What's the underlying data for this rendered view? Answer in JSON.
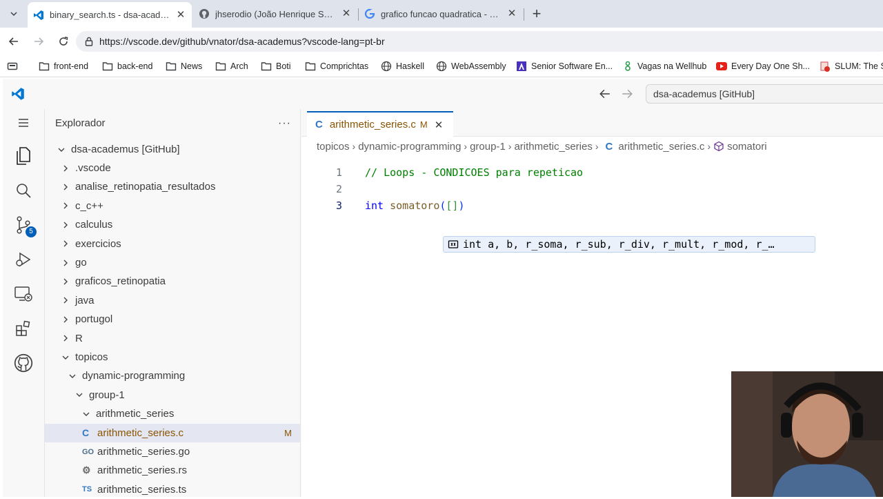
{
  "browser": {
    "tabs": [
      {
        "title": "binary_search.ts - dsa-academus [Gi",
        "icon": "vscode-icon",
        "active": true
      },
      {
        "title": "jhserodio (João Henrique Serodio)",
        "icon": "github-icon",
        "active": false
      },
      {
        "title": "grafico funcao quadratica - Pesqu",
        "icon": "google-icon",
        "active": false
      }
    ],
    "tab_close": "✕",
    "new_tab": "+",
    "url": "https://vscode.dev/github/vnator/dsa-academus?vscode-lang=pt-br",
    "bookmarks": [
      {
        "label": "front-end",
        "icon": "folder-icon"
      },
      {
        "label": "back-end",
        "icon": "folder-icon"
      },
      {
        "label": "News",
        "icon": "folder-icon"
      },
      {
        "label": "Arch",
        "icon": "folder-icon"
      },
      {
        "label": "Boti",
        "icon": "folder-icon"
      },
      {
        "label": "Comprichtas",
        "icon": "folder-icon"
      },
      {
        "label": "Haskell",
        "icon": "globe-icon"
      },
      {
        "label": "WebAssembly",
        "icon": "globe-icon"
      },
      {
        "label": "Senior Software En...",
        "icon": "bookmark-icon"
      },
      {
        "label": "Vagas na Wellhub",
        "icon": "wellhub-icon"
      },
      {
        "label": "Every Day One Sh...",
        "icon": "youtube-icon"
      },
      {
        "label": "SLUM: The Sh",
        "icon": "bookmark-icon"
      }
    ]
  },
  "vscode": {
    "command_center": "dsa-academus [GitHub]",
    "scm_badge": "5",
    "explorer": {
      "title": "Explorador",
      "root": "dsa-academus [GitHub]",
      "items": [
        {
          "label": ".vscode",
          "type": "folder",
          "expanded": false,
          "depth": 1
        },
        {
          "label": "analise_retinopatia_resultados",
          "type": "folder",
          "expanded": false,
          "depth": 1
        },
        {
          "label": "c_c++",
          "type": "folder",
          "expanded": false,
          "depth": 1
        },
        {
          "label": "calculus",
          "type": "folder",
          "expanded": false,
          "depth": 1
        },
        {
          "label": "exercicios",
          "type": "folder",
          "expanded": false,
          "depth": 1
        },
        {
          "label": "go",
          "type": "folder",
          "expanded": false,
          "depth": 1
        },
        {
          "label": "graficos_retinopatia",
          "type": "folder",
          "expanded": false,
          "depth": 1
        },
        {
          "label": "java",
          "type": "folder",
          "expanded": false,
          "depth": 1
        },
        {
          "label": "portugol",
          "type": "folder",
          "expanded": false,
          "depth": 1
        },
        {
          "label": "R",
          "type": "folder",
          "expanded": false,
          "depth": 1
        },
        {
          "label": "topicos",
          "type": "folder",
          "expanded": true,
          "depth": 1
        },
        {
          "label": "dynamic-programming",
          "type": "folder",
          "expanded": true,
          "depth": 2
        },
        {
          "label": "group-1",
          "type": "folder",
          "expanded": true,
          "depth": 3
        },
        {
          "label": "arithmetic_series",
          "type": "folder",
          "expanded": true,
          "depth": 4
        },
        {
          "label": "arithmetic_series.c",
          "type": "file",
          "icon_text": "C",
          "badge": "M",
          "selected": true,
          "depth": 5
        },
        {
          "label": "arithmetic_series.go",
          "type": "file",
          "icon_text": "GO",
          "depth": 5
        },
        {
          "label": "arithmetic_series.rs",
          "type": "file",
          "icon_text": "⚙",
          "depth": 5
        },
        {
          "label": "arithmetic_series.ts",
          "type": "file",
          "icon_text": "TS",
          "depth": 5
        }
      ]
    },
    "editor": {
      "tab": {
        "icon_text": "C",
        "label": "arithmetic_series.c",
        "badge": "M",
        "close": "✕"
      },
      "breadcrumb": [
        "topicos",
        "dynamic-programming",
        "group-1",
        "arithmetic_series",
        "arithmetic_series.c",
        "somatori"
      ],
      "breadcrumb_sep": "›",
      "lines": [
        {
          "num": "1",
          "text": "// Loops - CONDICOES para repeticao"
        },
        {
          "num": "2",
          "text": ""
        },
        {
          "num": "3",
          "text": "int somatoro([])"
        }
      ],
      "suggestion": "int a, b, r_soma, r_sub, r_div, r_mult, r_mod, r_…"
    }
  }
}
